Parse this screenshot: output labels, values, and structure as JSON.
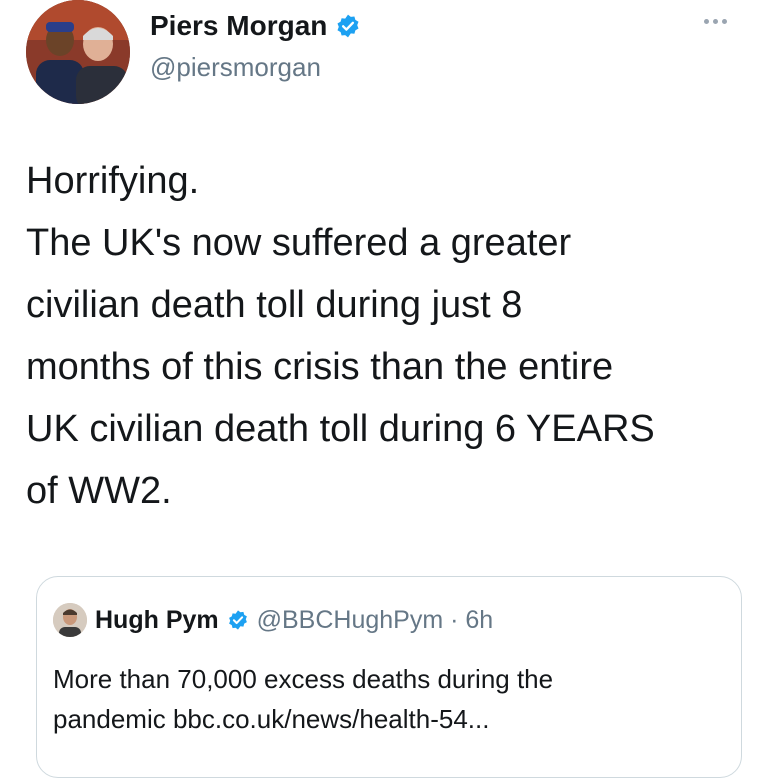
{
  "tweet": {
    "author": {
      "name": "Piers Morgan",
      "handle": "@piersmorgan",
      "verified": true
    },
    "text_lines": [
      "Horrifying.",
      "The UK's now suffered a greater",
      "civilian death toll during just 8",
      "months of this crisis than the entire",
      "UK civilian death toll during 6 YEARS",
      "of WW2."
    ],
    "more_icon": "more-horizontal-icon",
    "verified_icon": "verified-badge-icon"
  },
  "quote": {
    "author": {
      "name": "Hugh Pym",
      "handle_time": "@BBCHughPym · 6h",
      "verified": true
    },
    "text_lines": [
      "More than 70,000 excess deaths during the",
      "pandemic bbc.co.uk/news/health-54..."
    ]
  },
  "colors": {
    "verified": "#1da1f2",
    "secondary_text": "#657786",
    "primary_text": "#14171a",
    "card_border": "#cfd9de"
  }
}
